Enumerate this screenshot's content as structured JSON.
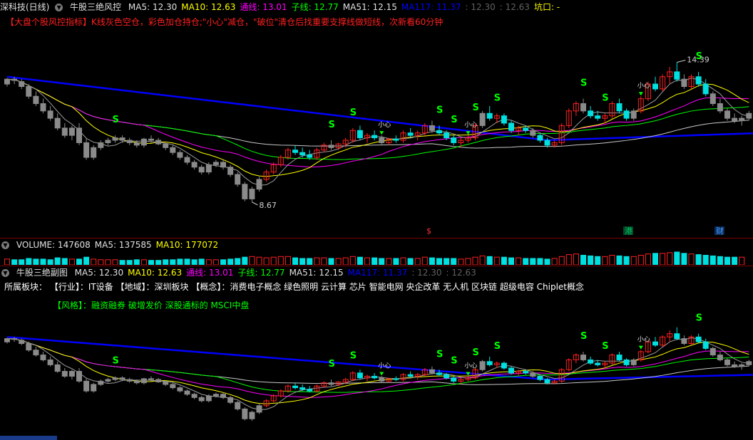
{
  "main_header": {
    "stock": "深科技(日线)",
    "indicator": "牛股三绝风控",
    "items": [
      {
        "label": "MA5: 12.30",
        "color": "#e0e0e0"
      },
      {
        "label": "MA10: 12.63",
        "color": "#ffff00"
      },
      {
        "label": "通线: 13.01",
        "color": "#ff00ff"
      },
      {
        "label": "子线: 12.77",
        "color": "#00ff00"
      },
      {
        "label": "MA51: 12.15",
        "color": "#e0e0e0"
      },
      {
        "label": "MA117: 11.37",
        "color": "#0000ff"
      },
      {
        "label": ": 12.30",
        "color": "#606060"
      },
      {
        "label": ": 12.63",
        "color": "#606060"
      },
      {
        "label": "坑口: -",
        "color": "#ffff00"
      }
    ]
  },
  "main_note": "【大盘个股风控指标】K线灰色空仓，彩色加仓持仓;\"小心\"减仓，\"破位\"清仓后找重要支撑线做短线，次新看60分钟",
  "main_chart": {
    "high_label": "14.39",
    "low_label": "8.67",
    "event_markers": [
      {
        "text": "$",
        "color": "#ff3030"
      },
      {
        "text": "港",
        "color": "#00c060"
      },
      {
        "text": "财",
        "color": "#4aa0ff"
      }
    ],
    "s_signal": "S",
    "caution_signal": "小心"
  },
  "volume_header": {
    "items": [
      {
        "label": "VOLUME: 147608",
        "color": "#e0e0e0"
      },
      {
        "label": "MA5: 137585",
        "color": "#e0e0e0"
      },
      {
        "label": "MA10: 177072",
        "color": "#ffff00"
      }
    ]
  },
  "sub_header": {
    "indicator": "牛股三绝副图",
    "items": [
      {
        "label": "MA5: 12.30",
        "color": "#e0e0e0"
      },
      {
        "label": "MA10: 12.63",
        "color": "#ffff00"
      },
      {
        "label": "通线: 13.01",
        "color": "#ff00ff"
      },
      {
        "label": "子线: 12.77",
        "color": "#00ff00"
      },
      {
        "label": "MA51: 12.15",
        "color": "#e0e0e0"
      },
      {
        "label": "MA117: 11.37",
        "color": "#0000ff"
      },
      {
        "label": ": 12.30",
        "color": "#606060"
      },
      {
        "label": ": 12.63",
        "color": "#606060"
      }
    ]
  },
  "sub_info": {
    "sector_line": "所属板块：  【行业】：IT设备  【地域】：深圳板块  【概念】：消费电子概念 绿色照明 云计算 芯片 智能电网 央企改革 无人机 区块链 超级电容 Chiplet概念",
    "style_line": "【风格】：融资融券 破增发价 深股通标的 MSCI中盘"
  },
  "colors": {
    "up": "#ff2020",
    "down": "#00e0e0",
    "gray": "#8a8a8a",
    "ma117": "#0000ff",
    "ma5": "#e0e0e0",
    "ma10": "#ffff00",
    "tong": "#ff00ff",
    "zi": "#00ff00",
    "signal": "#00ff00"
  },
  "series": [
    [
      13.5,
      13.75,
      13.4,
      13.7
    ],
    [
      13.7,
      13.8,
      13.5,
      13.65
    ],
    [
      13.6,
      13.7,
      13.3,
      13.4
    ],
    [
      13.4,
      13.5,
      12.9,
      13.0
    ],
    [
      13.0,
      13.2,
      12.6,
      12.7
    ],
    [
      12.7,
      12.9,
      12.3,
      12.4
    ],
    [
      12.4,
      12.6,
      12.0,
      12.1
    ],
    [
      12.1,
      12.3,
      11.6,
      11.7
    ],
    [
      11.7,
      11.9,
      11.3,
      11.4
    ],
    [
      11.4,
      11.8,
      11.2,
      11.7
    ],
    [
      11.7,
      11.9,
      11.0,
      11.1
    ],
    [
      11.1,
      11.3,
      10.4,
      10.5
    ],
    [
      10.5,
      11.0,
      10.4,
      10.9
    ],
    [
      10.9,
      11.2,
      10.8,
      11.1
    ],
    [
      11.1,
      11.3,
      11.0,
      11.2
    ],
    [
      11.2,
      11.4,
      11.1,
      11.3
    ],
    [
      11.3,
      11.4,
      11.1,
      11.2
    ],
    [
      11.2,
      11.3,
      11.0,
      11.1
    ],
    [
      11.1,
      11.2,
      10.9,
      11.0
    ],
    [
      11.0,
      11.3,
      10.9,
      11.25
    ],
    [
      11.25,
      11.4,
      11.1,
      11.2
    ],
    [
      11.2,
      11.3,
      11.0,
      11.05
    ],
    [
      11.05,
      11.1,
      10.8,
      10.9
    ],
    [
      10.9,
      11.0,
      10.6,
      10.7
    ],
    [
      10.7,
      10.8,
      10.4,
      10.5
    ],
    [
      10.5,
      10.6,
      10.2,
      10.3
    ],
    [
      10.3,
      10.4,
      10.0,
      10.1
    ],
    [
      10.1,
      10.2,
      9.8,
      9.9
    ],
    [
      9.9,
      10.3,
      9.8,
      10.2
    ],
    [
      10.2,
      10.4,
      10.1,
      10.3
    ],
    [
      10.3,
      10.4,
      10.0,
      10.1
    ],
    [
      10.1,
      10.2,
      9.7,
      9.8
    ],
    [
      9.8,
      9.9,
      9.3,
      9.4
    ],
    [
      9.4,
      9.5,
      8.7,
      8.8
    ],
    [
      8.8,
      9.3,
      8.67,
      9.2
    ],
    [
      9.2,
      9.7,
      9.1,
      9.6
    ],
    [
      9.6,
      10.0,
      9.5,
      9.9
    ],
    [
      9.9,
      10.3,
      9.8,
      10.2
    ],
    [
      10.2,
      10.6,
      10.1,
      10.5
    ],
    [
      10.5,
      10.9,
      10.4,
      10.8
    ],
    [
      10.8,
      11.0,
      10.6,
      10.7
    ],
    [
      10.7,
      10.9,
      10.5,
      10.6
    ],
    [
      10.6,
      10.8,
      10.4,
      10.5
    ],
    [
      10.5,
      10.9,
      10.4,
      10.8
    ],
    [
      10.8,
      11.1,
      10.7,
      11.0
    ],
    [
      11.0,
      11.2,
      10.8,
      10.9
    ],
    [
      10.9,
      11.1,
      10.8,
      11.05
    ],
    [
      11.05,
      11.3,
      10.9,
      11.2
    ],
    [
      11.2,
      11.7,
      11.1,
      11.6
    ],
    [
      11.6,
      11.8,
      11.2,
      11.3
    ],
    [
      11.3,
      11.5,
      11.1,
      11.4
    ],
    [
      11.4,
      11.6,
      11.2,
      11.3
    ],
    [
      11.3,
      11.4,
      11.0,
      11.1
    ],
    [
      11.1,
      11.3,
      11.0,
      11.25
    ],
    [
      11.25,
      11.4,
      11.1,
      11.2
    ],
    [
      11.2,
      11.6,
      11.1,
      11.5
    ],
    [
      11.5,
      11.7,
      11.3,
      11.4
    ],
    [
      11.4,
      11.6,
      11.2,
      11.5
    ],
    [
      11.5,
      11.9,
      11.4,
      11.8
    ],
    [
      11.8,
      12.0,
      11.5,
      11.6
    ],
    [
      11.6,
      11.8,
      11.4,
      11.5
    ],
    [
      11.5,
      11.6,
      11.2,
      11.3
    ],
    [
      11.3,
      11.4,
      11.0,
      11.1
    ],
    [
      11.1,
      11.3,
      10.9,
      11.2
    ],
    [
      11.2,
      11.4,
      11.1,
      11.3
    ],
    [
      11.3,
      11.9,
      11.2,
      11.8
    ],
    [
      11.8,
      12.4,
      11.7,
      12.3
    ],
    [
      12.3,
      12.6,
      12.0,
      12.1
    ],
    [
      12.1,
      12.3,
      11.9,
      12.2
    ],
    [
      12.2,
      12.3,
      11.8,
      11.9
    ],
    [
      11.9,
      12.0,
      11.5,
      11.6
    ],
    [
      11.6,
      11.8,
      11.4,
      11.7
    ],
    [
      11.7,
      11.8,
      11.5,
      11.6
    ],
    [
      11.6,
      11.7,
      11.3,
      11.4
    ],
    [
      11.4,
      11.5,
      11.1,
      11.2
    ],
    [
      11.2,
      11.3,
      10.9,
      11.0
    ],
    [
      11.0,
      11.2,
      10.9,
      11.1
    ],
    [
      11.1,
      11.9,
      11.0,
      11.8
    ],
    [
      11.8,
      12.5,
      11.7,
      12.4
    ],
    [
      12.4,
      12.8,
      12.2,
      12.7
    ],
    [
      12.7,
      12.9,
      12.3,
      12.4
    ],
    [
      12.4,
      12.6,
      12.1,
      12.2
    ],
    [
      12.2,
      12.4,
      12.0,
      12.1
    ],
    [
      12.1,
      12.3,
      11.9,
      12.2
    ],
    [
      12.2,
      12.8,
      12.1,
      12.7
    ],
    [
      12.7,
      12.9,
      12.3,
      12.4
    ],
    [
      12.4,
      12.5,
      12.0,
      12.1
    ],
    [
      12.1,
      12.5,
      12.0,
      12.4
    ],
    [
      12.4,
      13.0,
      12.3,
      12.9
    ],
    [
      12.9,
      13.6,
      12.8,
      13.5
    ],
    [
      13.5,
      13.8,
      13.2,
      13.3
    ],
    [
      13.3,
      13.9,
      13.2,
      13.8
    ],
    [
      13.8,
      14.2,
      13.5,
      14.0
    ],
    [
      14.0,
      14.39,
      13.6,
      13.7
    ],
    [
      13.7,
      13.9,
      13.3,
      13.4
    ],
    [
      13.4,
      13.9,
      13.3,
      13.8
    ],
    [
      13.8,
      14.0,
      13.4,
      13.5
    ],
    [
      13.5,
      13.7,
      13.0,
      13.1
    ],
    [
      13.1,
      13.2,
      12.6,
      12.7
    ],
    [
      12.7,
      12.9,
      12.3,
      12.4
    ],
    [
      12.4,
      12.5,
      12.0,
      12.1
    ],
    [
      12.1,
      12.3,
      11.9,
      12.0
    ],
    [
      12.0,
      12.2,
      11.8,
      12.1
    ],
    [
      12.1,
      12.4,
      12.0,
      12.3
    ]
  ],
  "volume": [
    9,
    8,
    8,
    10,
    9,
    9,
    8,
    11,
    10,
    9,
    9,
    12,
    9,
    8,
    8,
    8,
    7,
    7,
    8,
    8,
    7,
    7,
    8,
    8,
    9,
    9,
    8,
    9,
    8,
    8,
    8,
    9,
    10,
    12,
    13,
    12,
    11,
    12,
    13,
    13,
    11,
    10,
    10,
    11,
    11,
    10,
    10,
    11,
    13,
    12,
    11,
    11,
    10,
    10,
    10,
    11,
    10,
    10,
    12,
    11,
    10,
    10,
    10,
    9,
    10,
    12,
    14,
    13,
    12,
    12,
    11,
    11,
    10,
    10,
    10,
    9,
    10,
    13,
    16,
    17,
    15,
    14,
    13,
    13,
    15,
    14,
    13,
    13,
    15,
    17,
    18,
    18,
    19,
    20,
    18,
    17,
    16,
    15,
    14,
    13,
    12,
    12,
    12
  ]
}
